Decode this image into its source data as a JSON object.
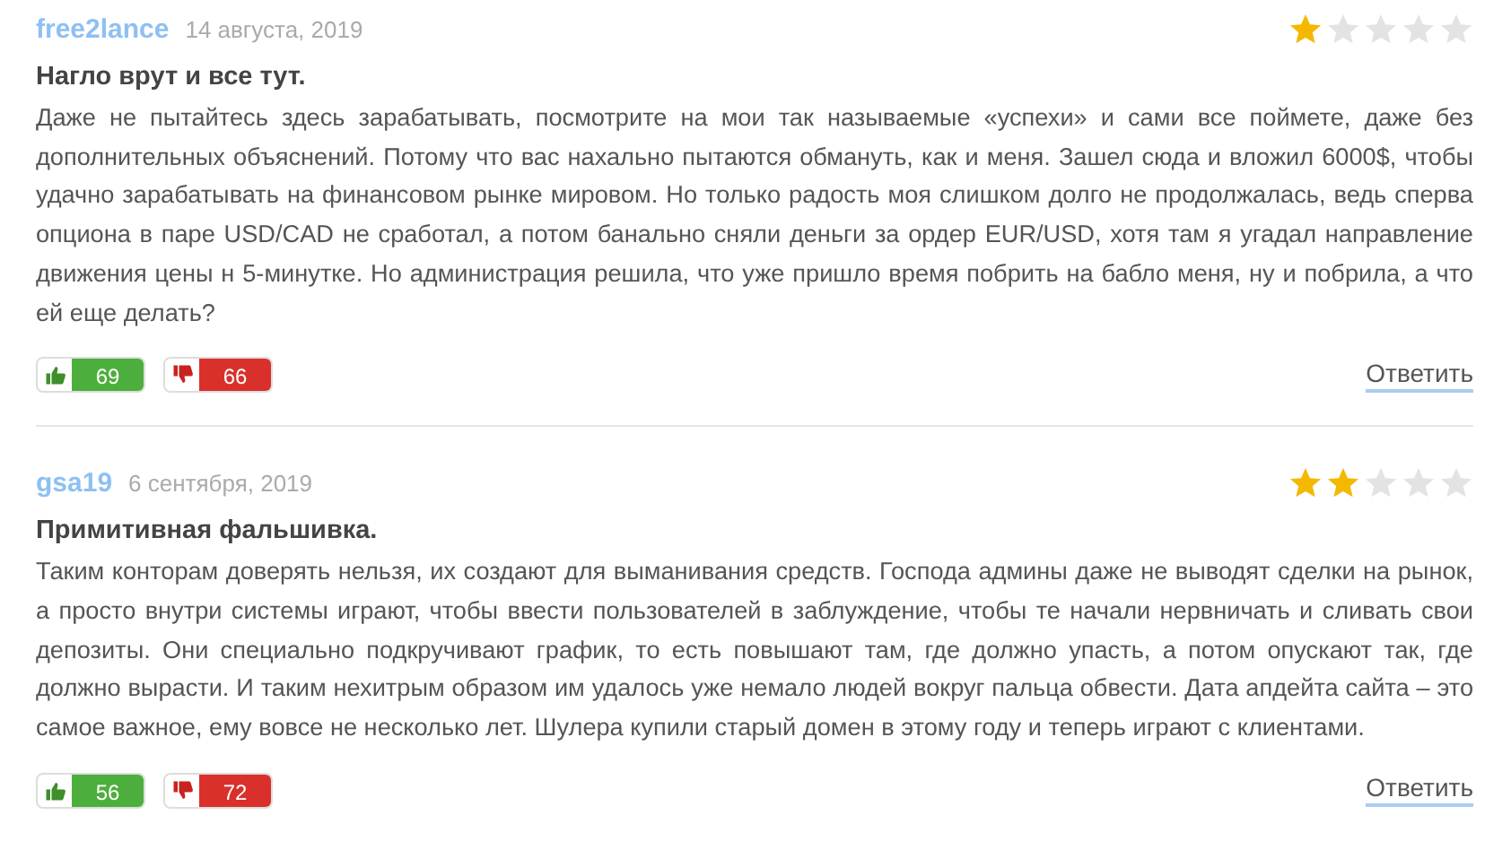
{
  "reviews": [
    {
      "author": "free2lance",
      "date": "14 августа, 2019",
      "stars": 1,
      "title": "Нагло врут и все тут.",
      "text": "Даже не пытайтесь здесь зарабатывать, посмотрите на мои так называемые «успехи» и сами все поймете, даже без дополнительных объяснений. Потому что вас нахально пытаются обмануть, как и меня. Зашел сюда и вложил 6000$, чтобы удачно зарабатывать на финансовом рынке мировом. Но только радость моя слишком долго не продолжалась, ведь сперва опциона в паре USD/CAD не сработал, а потом банально сняли деньги за ордер EUR/USD, хотя там я угадал направление движения цены н 5-минутке. Но администрация решила, что уже пришло время побрить на бабло меня, ну и побрила, а что ей еще делать?",
      "likes": "69",
      "dislikes": "66",
      "reply": "Ответить"
    },
    {
      "author": "gsa19",
      "date": "6 сентября, 2019",
      "stars": 2,
      "title": "Примитивная фальшивка.",
      "text": "Таким конторам доверять нельзя, их создают для выманивания средств. Господа админы даже не выводят сделки на рынок, а просто внутри системы играют, чтобы ввести пользователей в заблуждение, чтобы те начали нервничать и сливать свои депозиты. Они специально подкручивают график, то есть повышают там, где должно упасть, а потом опускают так, где должно вырасти. И таким нехитрым образом им удалось уже немало людей вокруг пальца обвести. Дата апдейта сайта – это самое важное, ему вовсе не несколько лет. Шулера купили старый домен в этому году и теперь играют с клиентами.",
      "likes": "56",
      "dislikes": "72",
      "reply": "Ответить"
    }
  ]
}
